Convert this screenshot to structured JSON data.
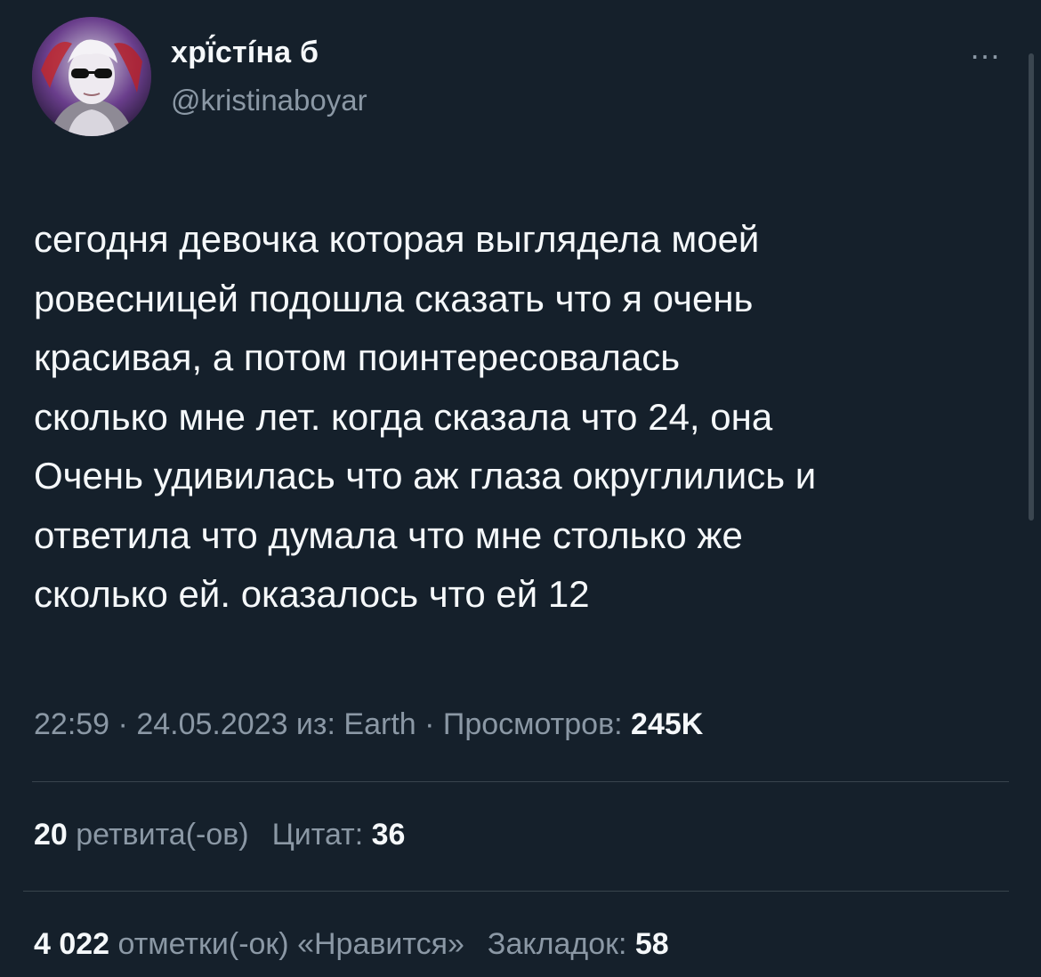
{
  "author": {
    "display_name": "хрї́стíна б",
    "handle": "@kristinaboyar"
  },
  "more_label": "…",
  "tweet": {
    "lines": [
      "сегодня девочка которая выглядела моей",
      "ровесницей подошла сказать что я очень",
      "красивая, а потом поинтересовалась",
      "сколько мне лет. когда сказала что 24, она",
      "Очень удивилась что аж глаза округлились и",
      "ответила что думала что мне столько же",
      "сколько ей. оказалось что ей 12"
    ]
  },
  "meta": {
    "time": "22:59",
    "sep1": " · ",
    "date": "24.05.2023",
    "source": " из: Earth",
    "sep2": " · ",
    "views_label": "Просмотров: ",
    "views_value": "245K"
  },
  "stats_row1": {
    "retweets_count": "20",
    "retweets_label": " ретвита(-ов)",
    "quotes_label": "Цитат: ",
    "quotes_count": "36"
  },
  "stats_row2": {
    "likes_count": "4 022",
    "likes_label": " отметки(-ок) «Нравится»",
    "bookmarks_label": "Закладок: ",
    "bookmarks_count": "58"
  },
  "colors": {
    "background": "#15202b",
    "text_primary": "#f5f8fa",
    "text_secondary": "#8b98a5",
    "divider": "#38444d"
  }
}
